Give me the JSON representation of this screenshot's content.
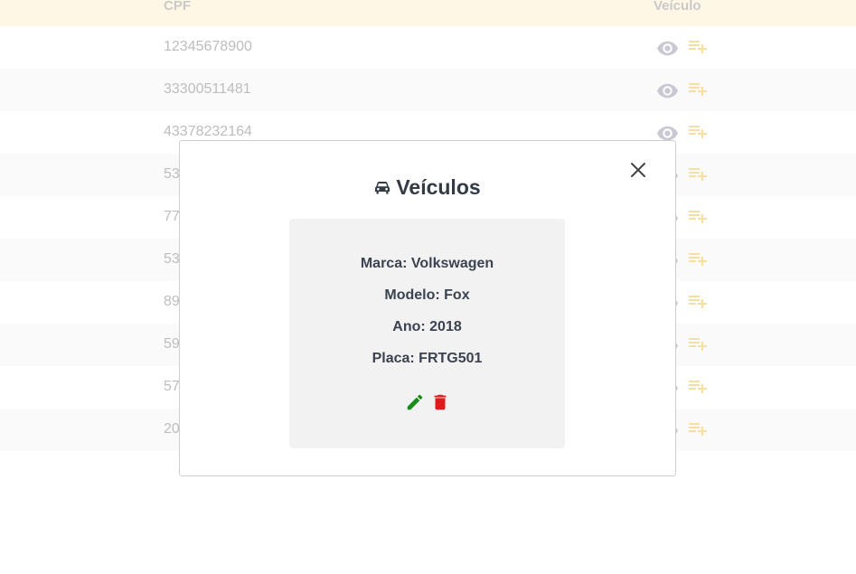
{
  "table": {
    "headers": {
      "cpf": "CPF",
      "veiculo": "Veículo"
    },
    "rows": [
      {
        "cpf": "12345678900"
      },
      {
        "cpf": "33300511481"
      },
      {
        "cpf": "43378232164"
      },
      {
        "cpf": "53"
      },
      {
        "cpf": "77"
      },
      {
        "cpf": "53"
      },
      {
        "cpf": "89"
      },
      {
        "cpf": "59"
      },
      {
        "cpf": "57"
      },
      {
        "cpf": "20"
      }
    ],
    "row_icons": [
      "eye-icon",
      "playlist-add-icon"
    ]
  },
  "modal": {
    "title": "Veículos",
    "title_icon": "car-icon",
    "vehicle": {
      "marca": "Marca: Volkswagen",
      "modelo": "Modelo: Fox",
      "ano": "Ano: 2018",
      "placa": "Placa: FRTG501"
    },
    "icons": {
      "edit": "pencil-icon",
      "delete": "trash-icon",
      "close": "close-icon"
    }
  },
  "colors": {
    "header_bg": "#fff7e6",
    "eye": "#c9c9d3",
    "add": "#f6dfa4",
    "edit": "#1a8a1a",
    "delete": "#e01b1b",
    "card_bg": "#f2f2f2",
    "title": "#333b44"
  }
}
